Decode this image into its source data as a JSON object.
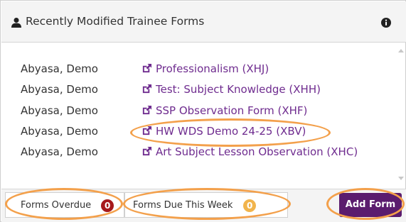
{
  "colors": {
    "link": "#6f2c8f",
    "overdue_badge": "#a6191c",
    "due_badge": "#f1b44c",
    "add_button": "#5b1c6e",
    "highlight": "#f3a04b"
  },
  "header": {
    "title": "Recently Modified Trainee Forms",
    "icon": "user-icon",
    "info_icon": "info-circle-icon"
  },
  "rows": [
    {
      "name": "Abyasa, Demo",
      "form": "Professionalism (XHJ)"
    },
    {
      "name": "Abyasa, Demo",
      "form": "Test: Subject Knowledge (XHH)"
    },
    {
      "name": "Abyasa, Demo",
      "form": "SSP Observation Form (XHF)"
    },
    {
      "name": "Abyasa, Demo",
      "form": "HW WDS Demo 24-25 (XBV)"
    },
    {
      "name": "Abyasa, Demo",
      "form": "Art Subject Lesson Observation (XHC)"
    }
  ],
  "footer": {
    "overdue_label": "Forms Overdue",
    "overdue_count": "0",
    "due_label": "Forms Due This Week",
    "due_count": "0",
    "add_label": "Add Form"
  }
}
